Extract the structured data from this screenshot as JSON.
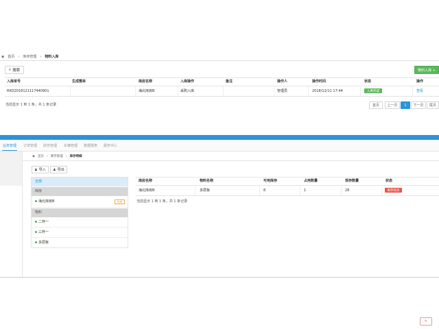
{
  "top": {
    "breadcrumb": [
      "首页",
      "库存管理",
      "物料入库"
    ],
    "search_button": "搜索",
    "add_button": "物料入库 +",
    "columns": [
      "入库单号",
      "生成需单",
      "库房名称",
      "入库操作",
      "备注",
      "操作人",
      "操作时间",
      "状态",
      "操作"
    ],
    "row": [
      "RKD20181211174409​01",
      "",
      "海北库房B",
      "采购入库",
      "",
      "管理员",
      "2018/12/11 17:44",
      "入库完成",
      "查看"
    ],
    "footer": "当前显示 1 到 1 条，共 1 条记录",
    "pagination": [
      "首页",
      "上一页",
      "1",
      "下一页",
      "尾页"
    ]
  },
  "colors": {
    "accent": "#2a94d9",
    "green": "#5cb85c",
    "red": "#e8544a",
    "orange": "#f0ad4e"
  },
  "bottom": {
    "tabs": [
      "业务管理",
      "订单管理",
      "财务管理",
      "车辆管理",
      "数据报表",
      "服务中心"
    ],
    "breadcrumb": [
      "首页",
      "库存管理",
      "库存明细"
    ],
    "import_button": "导入",
    "export_button": "导出",
    "tree": {
      "all": "全部",
      "warehouse_header": "库房",
      "warehouse_items": [
        {
          "label": "海北库房B",
          "tag": "库房"
        }
      ],
      "material_header": "物料",
      "material_items": [
        "二杯一",
        "三杯一",
        "多层板"
      ]
    },
    "columns": [
      "库房名称",
      "物料名称",
      "可用库存",
      "占用数量",
      "现存数量",
      "状态"
    ],
    "row": [
      "海北库房B",
      "多层板",
      "8",
      "1",
      "28",
      "库存缺货"
    ],
    "footer": "当前显示 1 到 1 条，共 1 条记录"
  }
}
